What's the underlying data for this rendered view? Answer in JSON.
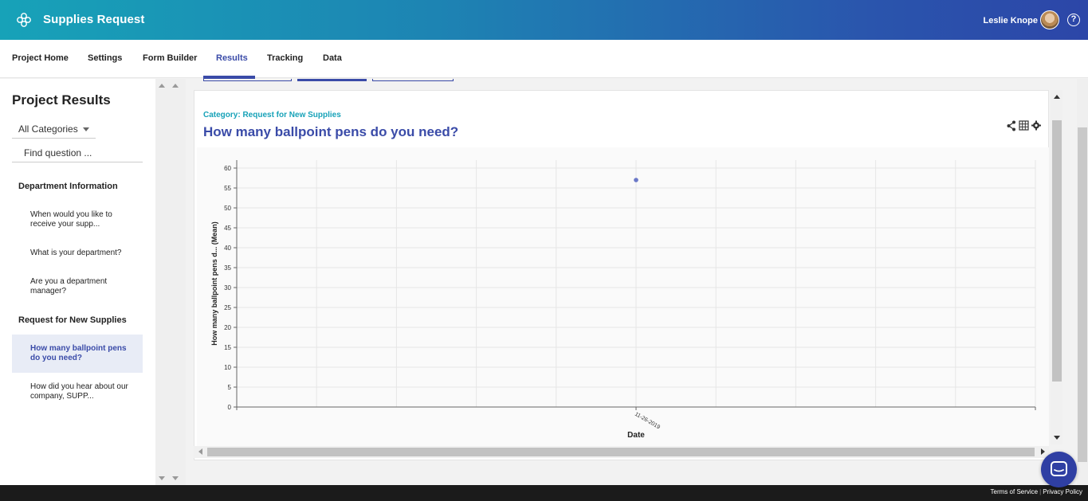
{
  "app": {
    "title": "Supplies Request",
    "user_name": "Leslie Knope",
    "help_label": "?"
  },
  "nav": {
    "items": [
      {
        "label": "Project Home"
      },
      {
        "label": "Settings"
      },
      {
        "label": "Form Builder"
      },
      {
        "label": "Results",
        "active": true
      },
      {
        "label": "Tracking"
      },
      {
        "label": "Data"
      }
    ]
  },
  "sidebar": {
    "title": "Project Results",
    "category_select": "All Categories",
    "find_placeholder": "Find question ...",
    "sections": [
      {
        "title": "Department Information",
        "questions": [
          "When would you like to receive your supp...",
          "What is your department?",
          "Are you a department manager?"
        ]
      },
      {
        "title": "Request for New Supplies",
        "questions": [
          "How many ballpoint pens do you need?",
          "How did you hear about our company, SUPP..."
        ]
      }
    ]
  },
  "result": {
    "category": "Category: Request for New Supplies",
    "question": "How many ballpoint pens do you need?"
  },
  "chart_data": {
    "type": "scatter",
    "title": "",
    "xlabel": "Date",
    "ylabel": "How many ballpoint pens d... (Mean)",
    "x": [
      "11-26-2019"
    ],
    "values": [
      57
    ],
    "ylim": [
      0,
      60
    ],
    "yticks": [
      0,
      5,
      10,
      15,
      20,
      25,
      30,
      35,
      40,
      45,
      50,
      55,
      60
    ],
    "grid": true,
    "point_color": "#6b78c8"
  },
  "footer": {
    "terms": "Terms of Service",
    "privacy": "Privacy Policy"
  },
  "colors": {
    "accent": "#3a4ba8",
    "teal": "#17a2b8",
    "footer": "#1b1b1b"
  }
}
